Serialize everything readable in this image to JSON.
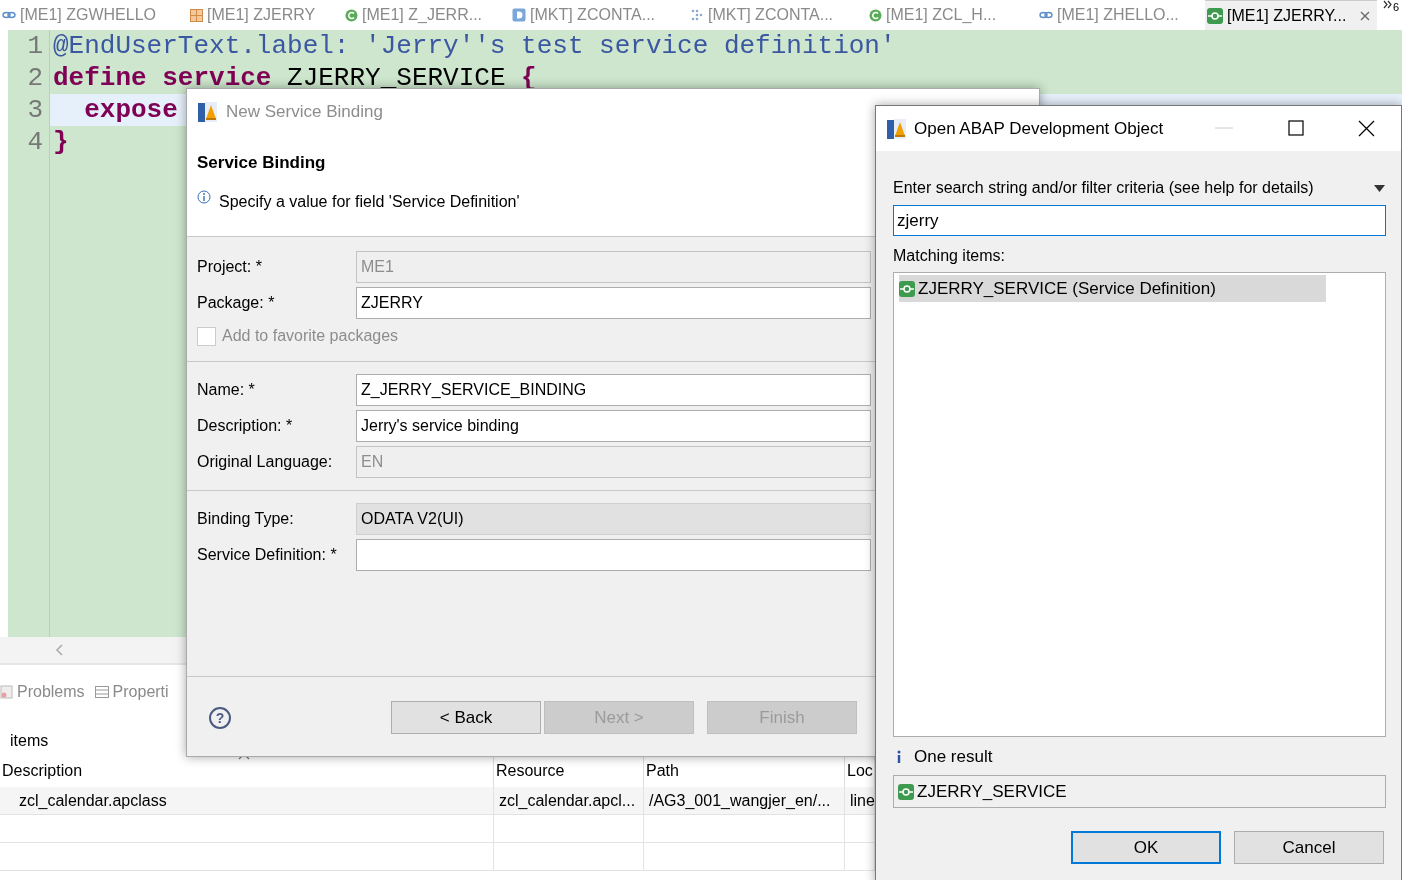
{
  "editor_tabs": [
    {
      "label": "[ME1] ZGWHELLO",
      "kind": "link",
      "selected": false
    },
    {
      "label": "[ME1] ZJERRY",
      "kind": "package",
      "selected": false
    },
    {
      "label": "[ME1] Z_JERR...",
      "kind": "class",
      "selected": false
    },
    {
      "label": "[MKT] ZCONTA...",
      "kind": "ddl",
      "selected": false
    },
    {
      "label": "[MKT] ZCONTA...",
      "kind": "dcl",
      "selected": false
    },
    {
      "label": "[ME1] ZCL_H...",
      "kind": "class",
      "selected": false
    },
    {
      "label": "[ME1] ZHELLO...",
      "kind": "link",
      "selected": false
    },
    {
      "label": "[ME1] ZJERRY...",
      "kind": "service",
      "selected": true
    }
  ],
  "tab_overflow": {
    "count": "6"
  },
  "editor": {
    "lines": [
      {
        "number": "1",
        "current": false,
        "tokens": [
          {
            "text": "@EndUserText.label: 'Jerry''s test service definition'",
            "kind": "annotation"
          }
        ]
      },
      {
        "number": "2",
        "current": false,
        "tokens": [
          {
            "text": "define",
            "kind": "keyword"
          },
          {
            "text": " service",
            "kind": "keyword"
          },
          {
            "text": " ZJERRY_SERVICE ",
            "kind": "plain"
          },
          {
            "text": "{",
            "kind": "keyword"
          }
        ]
      },
      {
        "number": "3",
        "current": true,
        "tokens": [
          {
            "text": "  expose",
            "kind": "keyword"
          }
        ]
      },
      {
        "number": "4",
        "current": false,
        "tokens": [
          {
            "text": "}",
            "kind": "keyword"
          }
        ]
      }
    ]
  },
  "bottom_panel": {
    "tabs": [
      {
        "label": "Problems",
        "kind": "problems"
      },
      {
        "label": "Properti",
        "kind": "properties"
      }
    ],
    "summary": "items",
    "table": {
      "columns": [
        "Description",
        "Resource",
        "Path",
        "Loc"
      ],
      "rows": [
        [
          "zcl_calendar.apclass",
          "zcl_calendar.apcl...",
          "/AG3_001_wangjer_en/...",
          "line"
        ]
      ]
    }
  },
  "new_binding_dialog": {
    "title": "New Service Binding",
    "heading": "Service Binding",
    "message": "Specify a value for field 'Service Definition'",
    "fields": [
      {
        "kind": "text",
        "label": "Project: *",
        "value": "ME1",
        "disabled": true
      },
      {
        "kind": "text",
        "label": "Package: *",
        "value": "ZJERRY",
        "disabled": false
      },
      {
        "kind": "checkbox",
        "label": "Add to favorite packages",
        "checked": false,
        "disabled": true
      },
      {
        "kind": "separator"
      },
      {
        "kind": "text",
        "label": "Name: *",
        "value": "Z_JERRY_SERVICE_BINDING",
        "disabled": false
      },
      {
        "kind": "text",
        "label": "Description: *",
        "value": "Jerry's service binding",
        "disabled": false
      },
      {
        "kind": "text",
        "label": "Original Language:",
        "value": "EN",
        "disabled": true
      },
      {
        "kind": "separator"
      },
      {
        "kind": "combo",
        "label": "Binding Type:",
        "value": "ODATA V2(UI)",
        "disabled": false
      },
      {
        "kind": "text",
        "label": "Service Definition: *",
        "disabled": false
      }
    ],
    "help_symbol": "?",
    "buttons": [
      {
        "label": "< Back",
        "disabled": false
      },
      {
        "label": "Next >",
        "disabled": true
      },
      {
        "label": "Finish",
        "disabled": true
      }
    ]
  },
  "open_object_dialog": {
    "title": "Open ABAP Development Object",
    "filter_label": "Enter search string and/or filter criteria (see help for details)",
    "search": {
      "value": "zjerry"
    },
    "matching_label": "Matching items:",
    "items": [
      {
        "label": "ZJERRY_SERVICE (Service Definition)",
        "selected": true
      }
    ],
    "status": "One result",
    "detail": "ZJERRY_SERVICE",
    "buttons": [
      {
        "label": "OK",
        "default": true
      },
      {
        "label": "Cancel",
        "default": false
      }
    ]
  }
}
